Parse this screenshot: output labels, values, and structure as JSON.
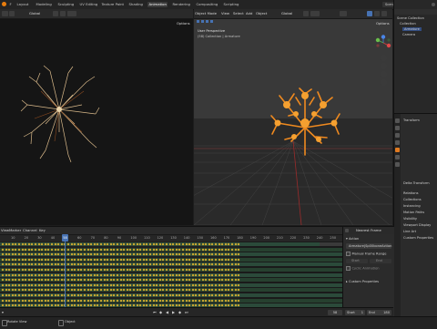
{
  "topbar": {
    "tabs": [
      "Layout",
      "Modeling",
      "Sculpting",
      "UV Editing",
      "Texture Paint",
      "Shading",
      "Animation",
      "Rendering",
      "Compositing",
      "Scripting"
    ],
    "active_tab": "Animation",
    "scene_label": "Scene"
  },
  "left_viewport": {
    "orientation": "Global",
    "options": "Options"
  },
  "right_viewport": {
    "mode": "Object Mode",
    "menus": [
      "View",
      "Select",
      "Add",
      "Object"
    ],
    "orientation": "Global",
    "options": "Options",
    "perspective_label": "User Perspective",
    "collection_label": "(58) Collection | Armature"
  },
  "outliner": {
    "items": [
      "Scene Collection",
      "Collection",
      "Armature",
      "Camera"
    ]
  },
  "properties": {
    "labels": [
      "Transform",
      "Delta Transform",
      "Relations",
      "Collections",
      "Instancing",
      "Motion Paths",
      "Visibility",
      "Viewport Display",
      "Line Art",
      "Custom Properties"
    ]
  },
  "timeline": {
    "menus": [
      "View",
      "Marker",
      "Channel",
      "Key"
    ],
    "frame_ticks": [
      "10",
      "20",
      "30",
      "40",
      "50",
      "60",
      "70",
      "80",
      "90",
      "100",
      "110",
      "120",
      "130",
      "140",
      "150",
      "160",
      "170",
      "180",
      "190",
      "200",
      "210",
      "220",
      "230",
      "240",
      "250"
    ],
    "current_frame": "58"
  },
  "action_panel": {
    "title": "Nearest Frame",
    "section": "Action",
    "action_name": "Armature|Sp00boneAction",
    "manual_range": "Manual Frame Range",
    "start_label": "Start",
    "end_label": "End",
    "cyclic": "Cyclic Animation",
    "custom_props": "Custom Properties"
  },
  "playbar": {
    "current": "58",
    "start_label": "Start",
    "start": "1",
    "end_label": "End",
    "end": "180"
  },
  "statusbar": {
    "left": "Rotate View",
    "mid": "Object"
  },
  "colors": {
    "accent_blue": "#4772b3",
    "tree_left": "#d9b98a",
    "tree_right": "#f08a1f",
    "keyframe": "#e8b830"
  }
}
